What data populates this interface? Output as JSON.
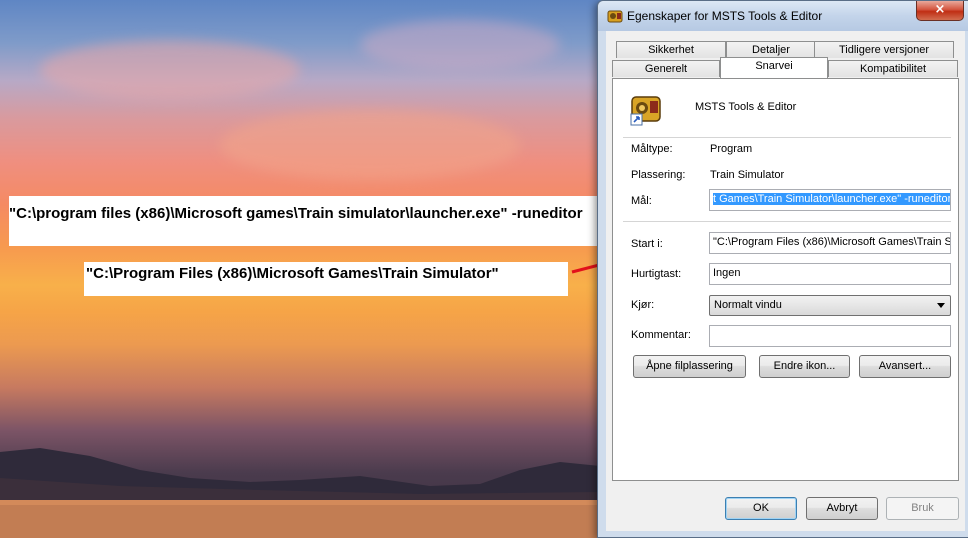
{
  "notes": {
    "target_note": "\"C:\\program files (x86)\\Microsoft games\\Train simulator\\launcher.exe\" -runeditor",
    "startin_note": "\"C:\\Program Files (x86)\\Microsoft Games\\Train Simulator\""
  },
  "dialog": {
    "title": "Egenskaper for MSTS Tools & Editor",
    "close_glyph": "×",
    "tabs": {
      "row_top": [
        "Sikkerhet",
        "Detaljer",
        "Tidligere versjoner"
      ],
      "row_bottom": [
        "Generelt",
        "Snarvei",
        "Kompatibilitet"
      ],
      "active": "Snarvei"
    },
    "shortcut_name": "MSTS Tools & Editor",
    "fields": {
      "target_type_label": "Måltype:",
      "target_type_value": "Program",
      "location_label": "Plassering:",
      "location_value": "Train Simulator",
      "target_label": "Mål:",
      "target_value": "t Games\\Train Simulator\\launcher.exe\" -runeditor",
      "start_in_label": "Start i:",
      "start_in_value": "\"C:\\Program Files (x86)\\Microsoft Games\\Train Si",
      "hotkey_label": "Hurtigtast:",
      "hotkey_value": "Ingen",
      "run_label": "Kjør:",
      "run_value": "Normalt vindu",
      "comment_label": "Kommentar:",
      "comment_value": ""
    },
    "buttons": {
      "open_location": "Åpne filplassering",
      "change_icon": "Endre ikon...",
      "advanced": "Avansert...",
      "ok": "OK",
      "cancel": "Avbryt",
      "apply": "Bruk"
    }
  },
  "colors": {
    "annotation_line": "#e3111b",
    "selection": "#3399ff"
  }
}
